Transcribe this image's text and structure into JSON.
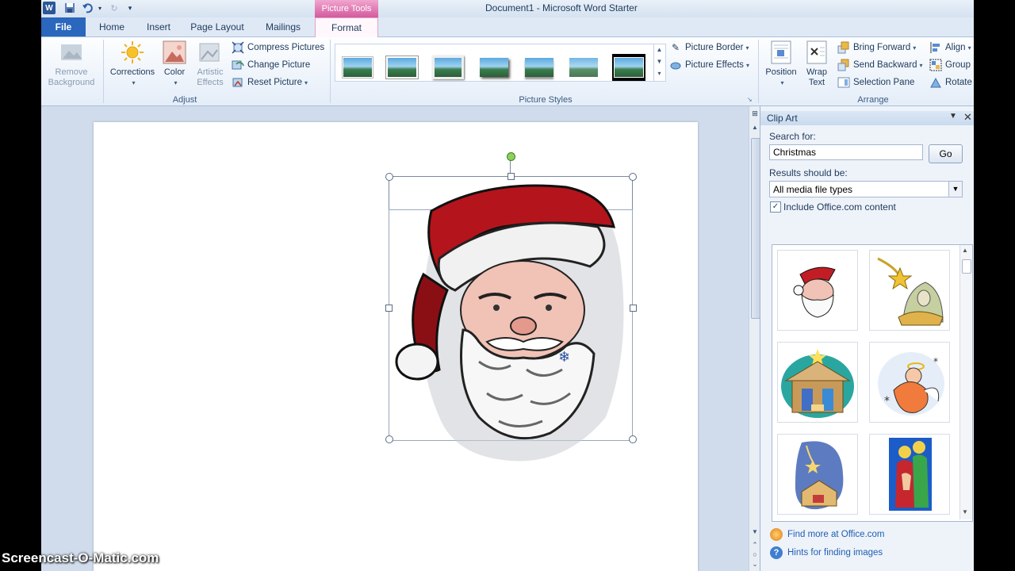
{
  "window": {
    "title": "Document1  -  Microsoft Word Starter",
    "context_tab": "Picture Tools"
  },
  "qat": {
    "word_logo": "W"
  },
  "tabs": [
    {
      "label": "File"
    },
    {
      "label": "Home"
    },
    {
      "label": "Insert"
    },
    {
      "label": "Page Layout"
    },
    {
      "label": "Mailings"
    },
    {
      "label": "Format"
    }
  ],
  "ribbon": {
    "adjust": {
      "label": "Adjust",
      "remove_background": "Remove Background",
      "corrections": "Corrections",
      "color": "Color",
      "artistic_effects": "Artistic Effects",
      "compress_pictures": "Compress Pictures",
      "change_picture": "Change Picture",
      "reset_picture": "Reset Picture"
    },
    "picture_styles": {
      "label": "Picture Styles",
      "picture_border": "Picture Border",
      "picture_effects": "Picture Effects"
    },
    "arrange": {
      "label": "Arrange",
      "position": "Position",
      "wrap_text": "Wrap Text",
      "bring_forward": "Bring Forward",
      "send_backward": "Send Backward",
      "selection_pane": "Selection Pane",
      "align": "Align",
      "group": "Group",
      "rotate": "Rotate"
    }
  },
  "clip_art": {
    "title": "Clip Art",
    "search_label": "Search for:",
    "search_value": "Christmas",
    "go": "Go",
    "results_label": "Results should be:",
    "results_value": "All media file types",
    "include_label": "Include Office.com content",
    "include_checked": true,
    "results": [
      {
        "icon": "santa-icon"
      },
      {
        "icon": "nativity-star-icon"
      },
      {
        "icon": "manger-stable-icon"
      },
      {
        "icon": "angel-icon"
      },
      {
        "icon": "shooting-star-nativity-icon"
      },
      {
        "icon": "holy-family-icon"
      }
    ],
    "find_more": "Find more at Office.com",
    "hints": "Hints for finding images"
  },
  "watermark": "Screencast-O-Matic.com",
  "colors": {
    "file_tab": "#2a67bd",
    "context_tab": "#d35a9e",
    "link": "#1f5fb0"
  }
}
